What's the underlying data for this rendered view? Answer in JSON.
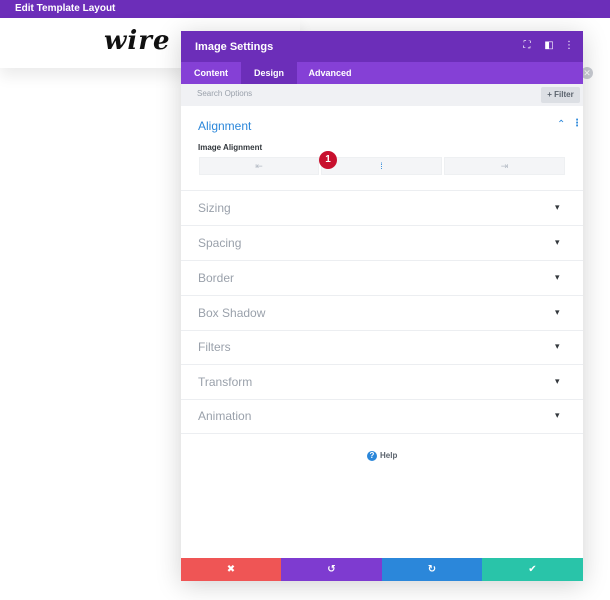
{
  "topbar": {
    "title": "Edit Template Layout"
  },
  "background": {
    "logo_text": "wire",
    "close_icon": "close-icon"
  },
  "modal": {
    "title": "Image Settings",
    "header_icons": [
      "expand-icon",
      "sidebar-toggle-icon",
      "kebab-menu-icon"
    ],
    "tabs": [
      {
        "label": "Content",
        "active": false
      },
      {
        "label": "Design",
        "active": true
      },
      {
        "label": "Advanced",
        "active": false
      }
    ],
    "search": {
      "placeholder": "Search Options",
      "filter_label": "+ Filter"
    },
    "open_section": {
      "title": "Alignment",
      "field_label": "Image Alignment",
      "options": [
        {
          "icon": "align-left-icon",
          "glyph": "⇤",
          "active": false
        },
        {
          "icon": "align-center-icon",
          "glyph": "⁞",
          "active": true
        },
        {
          "icon": "align-right-icon",
          "glyph": "⇥",
          "active": false
        }
      ],
      "badge": "1"
    },
    "sections": [
      "Sizing",
      "Spacing",
      "Border",
      "Box Shadow",
      "Filters",
      "Transform",
      "Animation"
    ],
    "help_label": "Help",
    "footer": [
      {
        "name": "discard-button",
        "glyph": "✖",
        "color": "#ef5555"
      },
      {
        "name": "undo-button",
        "glyph": "↺",
        "color": "#7e3bd0"
      },
      {
        "name": "redo-button",
        "glyph": "↻",
        "color": "#2b87da"
      },
      {
        "name": "save-button",
        "glyph": "✔",
        "color": "#29c4a9"
      }
    ]
  },
  "colors": {
    "primary_purple": "#6c2eb9",
    "tab_purple": "#8540d6",
    "accent_blue": "#2b87da",
    "badge_red": "#c8102e"
  }
}
